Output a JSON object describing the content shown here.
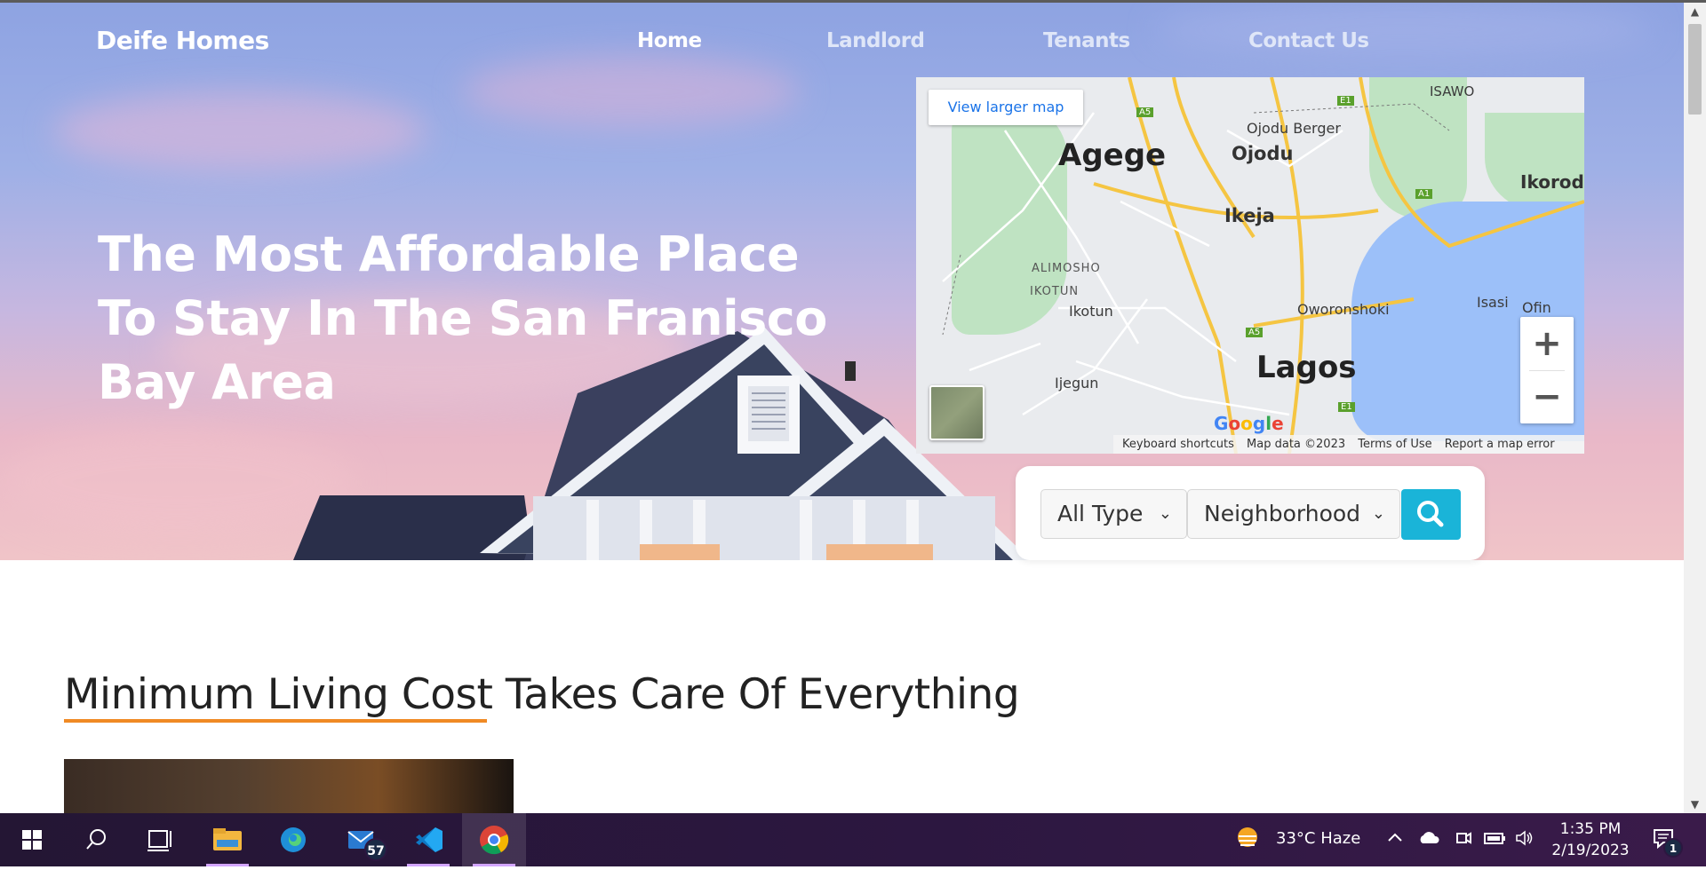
{
  "header": {
    "brand": "Deife Homes",
    "nav": [
      {
        "label": "Home"
      },
      {
        "label": "Landlord"
      },
      {
        "label": "Tenants"
      },
      {
        "label": "Contact Us"
      }
    ]
  },
  "hero": {
    "headline": "The Most Affordable Place To Stay In The San Franisco Bay Area"
  },
  "map": {
    "view_larger": "View larger map",
    "places": [
      "ISAWO",
      "Ojodu Berger",
      "Agege",
      "Ojodu",
      "Ikorodu",
      "Ikeja",
      "ALIMOSHO",
      "IKOTUN",
      "Ikotun",
      "Oworonshoki",
      "Isasi",
      "Ofin",
      "Lagos",
      "Ijegun"
    ],
    "roads": [
      "A5",
      "E1",
      "A1",
      "A5",
      "E1"
    ],
    "zoom_in": "+",
    "zoom_out": "−",
    "footer": [
      "Keyboard shortcuts",
      "Map data ©2023",
      "Terms of Use",
      "Report a map error"
    ],
    "logo": "Google"
  },
  "search": {
    "type_value": "All Type",
    "neighborhood_value": "Neighborhood"
  },
  "section": {
    "title": "Minimum Living Cost Takes Care Of Everything"
  },
  "taskbar": {
    "weather": "33°C  Haze",
    "mail_badge": "57",
    "time": "1:35 PM",
    "date": "2/19/2023",
    "notification_badge": "1"
  },
  "colors": {
    "accent_underline": "#f08a24",
    "search_button": "#1ab4d8",
    "map_water": "#9cc0f9"
  }
}
